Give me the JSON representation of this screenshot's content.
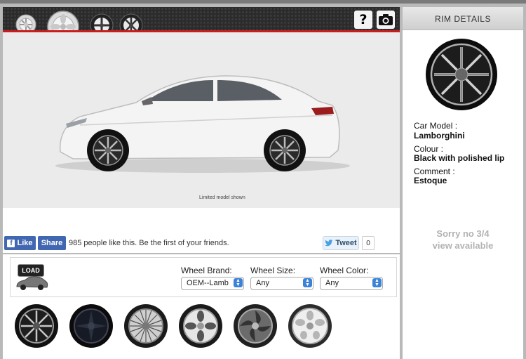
{
  "viewer": {
    "help_icon": "question-icon",
    "camera_icon": "camera-icon",
    "caption": "Limited model shown"
  },
  "social": {
    "like_label": "Like",
    "share_label": "Share",
    "like_text": "985 people like this. Be the first of your friends.",
    "tweet_label": "Tweet",
    "tweet_count": "0"
  },
  "controls": {
    "load_label": "LOAD",
    "brand": {
      "label": "Wheel Brand:",
      "value": "OEM--Lamb"
    },
    "size": {
      "label": "Wheel Size:",
      "value": "Any"
    },
    "color": {
      "label": "Wheel Color:",
      "value": "Any"
    }
  },
  "rim_details": {
    "title": "RIM DETAILS",
    "car_model_label": "Car Model :",
    "car_model_value": "Lamborghini",
    "colour_label": "Colour :",
    "colour_value": "Black with polished lip",
    "comment_label": "Comment :",
    "comment_value": "Estoque",
    "sorry_line1": "Sorry no 3/4",
    "sorry_line2": "view available"
  },
  "colors": {
    "accent_red": "#c81e1e",
    "facebook_blue": "#4267b2",
    "select_arrow_blue": "#3b82d8"
  }
}
